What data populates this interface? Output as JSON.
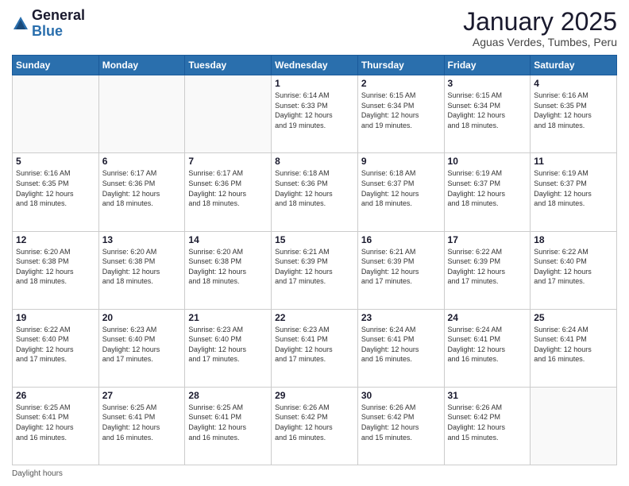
{
  "logo": {
    "general": "General",
    "blue": "Blue"
  },
  "header": {
    "month": "January 2025",
    "location": "Aguas Verdes, Tumbes, Peru"
  },
  "days_of_week": [
    "Sunday",
    "Monday",
    "Tuesday",
    "Wednesday",
    "Thursday",
    "Friday",
    "Saturday"
  ],
  "footer": {
    "daylight_label": "Daylight hours"
  },
  "weeks": [
    {
      "days": [
        {
          "number": "",
          "info": ""
        },
        {
          "number": "",
          "info": ""
        },
        {
          "number": "",
          "info": ""
        },
        {
          "number": "1",
          "info": "Sunrise: 6:14 AM\nSunset: 6:33 PM\nDaylight: 12 hours\nand 19 minutes."
        },
        {
          "number": "2",
          "info": "Sunrise: 6:15 AM\nSunset: 6:34 PM\nDaylight: 12 hours\nand 19 minutes."
        },
        {
          "number": "3",
          "info": "Sunrise: 6:15 AM\nSunset: 6:34 PM\nDaylight: 12 hours\nand 18 minutes."
        },
        {
          "number": "4",
          "info": "Sunrise: 6:16 AM\nSunset: 6:35 PM\nDaylight: 12 hours\nand 18 minutes."
        }
      ]
    },
    {
      "days": [
        {
          "number": "5",
          "info": "Sunrise: 6:16 AM\nSunset: 6:35 PM\nDaylight: 12 hours\nand 18 minutes."
        },
        {
          "number": "6",
          "info": "Sunrise: 6:17 AM\nSunset: 6:36 PM\nDaylight: 12 hours\nand 18 minutes."
        },
        {
          "number": "7",
          "info": "Sunrise: 6:17 AM\nSunset: 6:36 PM\nDaylight: 12 hours\nand 18 minutes."
        },
        {
          "number": "8",
          "info": "Sunrise: 6:18 AM\nSunset: 6:36 PM\nDaylight: 12 hours\nand 18 minutes."
        },
        {
          "number": "9",
          "info": "Sunrise: 6:18 AM\nSunset: 6:37 PM\nDaylight: 12 hours\nand 18 minutes."
        },
        {
          "number": "10",
          "info": "Sunrise: 6:19 AM\nSunset: 6:37 PM\nDaylight: 12 hours\nand 18 minutes."
        },
        {
          "number": "11",
          "info": "Sunrise: 6:19 AM\nSunset: 6:37 PM\nDaylight: 12 hours\nand 18 minutes."
        }
      ]
    },
    {
      "days": [
        {
          "number": "12",
          "info": "Sunrise: 6:20 AM\nSunset: 6:38 PM\nDaylight: 12 hours\nand 18 minutes."
        },
        {
          "number": "13",
          "info": "Sunrise: 6:20 AM\nSunset: 6:38 PM\nDaylight: 12 hours\nand 18 minutes."
        },
        {
          "number": "14",
          "info": "Sunrise: 6:20 AM\nSunset: 6:38 PM\nDaylight: 12 hours\nand 18 minutes."
        },
        {
          "number": "15",
          "info": "Sunrise: 6:21 AM\nSunset: 6:39 PM\nDaylight: 12 hours\nand 17 minutes."
        },
        {
          "number": "16",
          "info": "Sunrise: 6:21 AM\nSunset: 6:39 PM\nDaylight: 12 hours\nand 17 minutes."
        },
        {
          "number": "17",
          "info": "Sunrise: 6:22 AM\nSunset: 6:39 PM\nDaylight: 12 hours\nand 17 minutes."
        },
        {
          "number": "18",
          "info": "Sunrise: 6:22 AM\nSunset: 6:40 PM\nDaylight: 12 hours\nand 17 minutes."
        }
      ]
    },
    {
      "days": [
        {
          "number": "19",
          "info": "Sunrise: 6:22 AM\nSunset: 6:40 PM\nDaylight: 12 hours\nand 17 minutes."
        },
        {
          "number": "20",
          "info": "Sunrise: 6:23 AM\nSunset: 6:40 PM\nDaylight: 12 hours\nand 17 minutes."
        },
        {
          "number": "21",
          "info": "Sunrise: 6:23 AM\nSunset: 6:40 PM\nDaylight: 12 hours\nand 17 minutes."
        },
        {
          "number": "22",
          "info": "Sunrise: 6:23 AM\nSunset: 6:41 PM\nDaylight: 12 hours\nand 17 minutes."
        },
        {
          "number": "23",
          "info": "Sunrise: 6:24 AM\nSunset: 6:41 PM\nDaylight: 12 hours\nand 16 minutes."
        },
        {
          "number": "24",
          "info": "Sunrise: 6:24 AM\nSunset: 6:41 PM\nDaylight: 12 hours\nand 16 minutes."
        },
        {
          "number": "25",
          "info": "Sunrise: 6:24 AM\nSunset: 6:41 PM\nDaylight: 12 hours\nand 16 minutes."
        }
      ]
    },
    {
      "days": [
        {
          "number": "26",
          "info": "Sunrise: 6:25 AM\nSunset: 6:41 PM\nDaylight: 12 hours\nand 16 minutes."
        },
        {
          "number": "27",
          "info": "Sunrise: 6:25 AM\nSunset: 6:41 PM\nDaylight: 12 hours\nand 16 minutes."
        },
        {
          "number": "28",
          "info": "Sunrise: 6:25 AM\nSunset: 6:41 PM\nDaylight: 12 hours\nand 16 minutes."
        },
        {
          "number": "29",
          "info": "Sunrise: 6:26 AM\nSunset: 6:42 PM\nDaylight: 12 hours\nand 16 minutes."
        },
        {
          "number": "30",
          "info": "Sunrise: 6:26 AM\nSunset: 6:42 PM\nDaylight: 12 hours\nand 15 minutes."
        },
        {
          "number": "31",
          "info": "Sunrise: 6:26 AM\nSunset: 6:42 PM\nDaylight: 12 hours\nand 15 minutes."
        },
        {
          "number": "",
          "info": ""
        }
      ]
    }
  ]
}
